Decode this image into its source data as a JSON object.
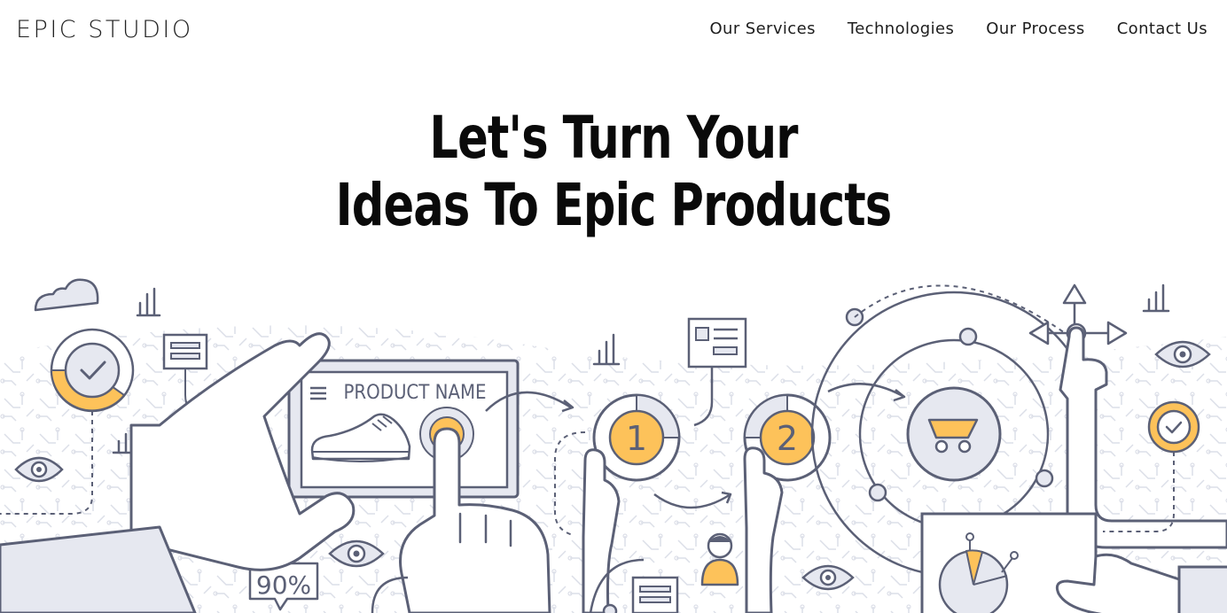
{
  "brand": {
    "logo_text": "EPIC STUDIO"
  },
  "nav": {
    "items": [
      {
        "label": "Our Services"
      },
      {
        "label": "Technologies"
      },
      {
        "label": "Our Process"
      },
      {
        "label": "Contact Us"
      }
    ]
  },
  "hero": {
    "title_line1": "Let's Turn Your",
    "title_line2": "Ideas To Epic Products"
  },
  "illustration": {
    "product_label": "PRODUCT NAME",
    "step_one": "1",
    "step_two": "2",
    "percent_badge": "%",
    "percent_value": "90%",
    "accent_color": "#FDC25A",
    "line_color": "#5B6076",
    "fill_light": "#E6E8F0"
  }
}
